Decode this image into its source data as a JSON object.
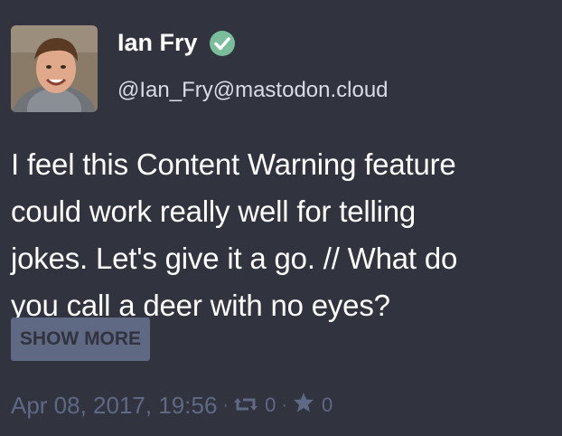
{
  "status": {
    "display_name": "Ian Fry",
    "acct": "@Ian_Fry@mastodon.cloud",
    "verified_icon": "check-circle-icon",
    "content_lines": [
      "I feel this Content Warning feature",
      "could work really well for telling",
      "jokes. Let's give it a go. // What do",
      "you call a deer with no eyes?"
    ],
    "show_more_label": "SHOW MORE",
    "timestamp": "Apr 08, 2017, 19:56",
    "separator": "·",
    "boost_icon": "retweet-icon",
    "boost_count": "0",
    "favourite_icon": "star-icon",
    "favourite_count": "0"
  },
  "colors": {
    "background": "#31333f",
    "verified": "#79bd9a",
    "muted": "#606984",
    "acct": "#d9dce4"
  }
}
